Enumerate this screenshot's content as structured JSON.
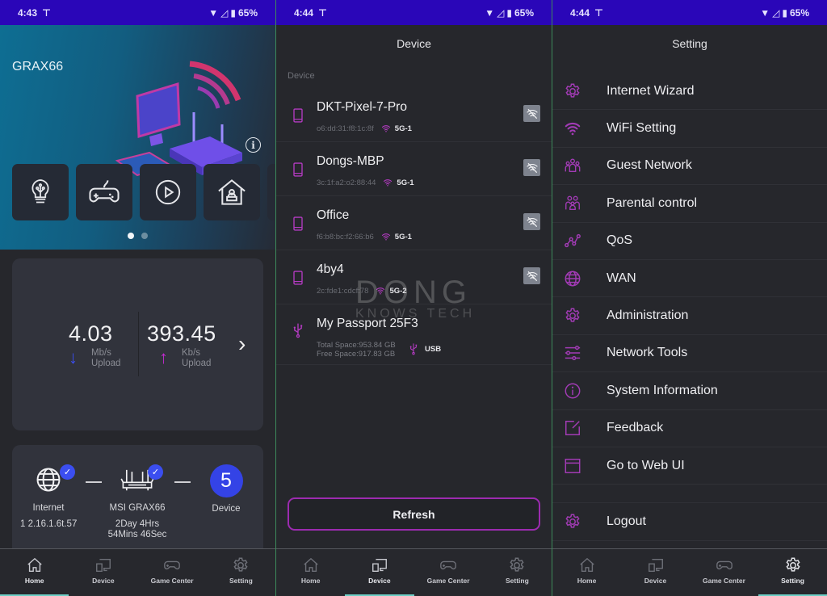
{
  "colors": {
    "status_bar": "#2a06b8",
    "accent_purple": "#9c2bb0",
    "download_blue": "#3b4ef0",
    "upload_magenta": "#c42bd2",
    "tab_indicator": "#6ccfc6"
  },
  "screens": [
    {
      "status_bar": {
        "time": "4:43",
        "battery": "65%"
      },
      "hero": {
        "title": "GRAX66",
        "info_icon": "i",
        "quick_actions": [
          "lightbulb-icon",
          "gamepad-icon",
          "play-icon",
          "home-user-icon"
        ],
        "carousel": {
          "pages": 2,
          "current": 1
        }
      },
      "speed": {
        "download": {
          "value": "4.03",
          "unit": "Mb/s",
          "label": "Upload",
          "arrow": "↓"
        },
        "upload": {
          "value": "393.45",
          "unit": "Kb/s",
          "label": "Upload",
          "arrow": "↑"
        },
        "chevron": "›"
      },
      "network": {
        "internet": {
          "label": "Internet",
          "detail": "1 2.16.1.6t.57"
        },
        "router": {
          "label": "MSI GRAX66",
          "detail_line1": "2Day 4Hrs",
          "detail_line2": "54Mins 46Sec"
        },
        "devices": {
          "count": "5",
          "label": "Device"
        },
        "check": "✓"
      }
    },
    {
      "status_bar": {
        "time": "4:44",
        "battery": "65%"
      },
      "title": "Device",
      "section_label": "Device",
      "devices": [
        {
          "name": "DKT-Pixel-7-Pro",
          "mac": "o6:dd:31:f8:1c:8f",
          "band": "5G-1"
        },
        {
          "name": "Dongs-MBP",
          "mac": "3c:1f:a2:o2:88:44",
          "band": "5G-1"
        },
        {
          "name": "Office",
          "mac": "f6:b8:bc:f2:66:b6",
          "band": "5G-1"
        },
        {
          "name": "4by4",
          "mac": "2c:fde1:cdcf:78",
          "band": "5G-2"
        }
      ],
      "usb_device": {
        "name": "My Passport 25F3",
        "total": "Total Space:953.84 GB",
        "free": "Free Space:917.83 GB",
        "type": "USB"
      },
      "watermark": {
        "line1": "DONG",
        "line2": "KNOWS TECH"
      },
      "refresh_label": "Refresh"
    },
    {
      "status_bar": {
        "time": "4:44",
        "battery": "65%"
      },
      "title": "Setting",
      "items": [
        {
          "label": "Internet Wizard",
          "icon": "gear-icon"
        },
        {
          "label": "WiFi Setting",
          "icon": "wifi-icon"
        },
        {
          "label": "Guest Network",
          "icon": "users-icon"
        },
        {
          "label": "Parental control",
          "icon": "family-icon"
        },
        {
          "label": "QoS",
          "icon": "graph-icon"
        },
        {
          "label": "WAN",
          "icon": "globe-icon"
        },
        {
          "label": "Administration",
          "icon": "gear-icon"
        },
        {
          "label": "Network Tools",
          "icon": "sliders-icon"
        },
        {
          "label": "System Information",
          "icon": "info-icon"
        },
        {
          "label": "Feedback",
          "icon": "edit-icon"
        },
        {
          "label": "Go to Web UI",
          "icon": "browser-icon"
        }
      ],
      "logout": {
        "label": "Logout",
        "icon": "gear-icon"
      }
    }
  ],
  "tabbar": {
    "tabs": [
      {
        "label": "Home",
        "icon": "home-icon"
      },
      {
        "label": "Device",
        "icon": "device-icon"
      },
      {
        "label": "Game Center",
        "icon": "gamepad-icon"
      },
      {
        "label": "Setting",
        "icon": "gear-icon"
      }
    ]
  }
}
